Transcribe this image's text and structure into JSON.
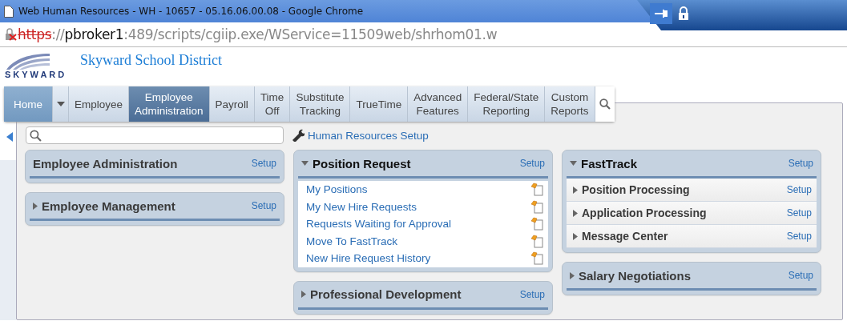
{
  "window": {
    "title": "Web Human Resources - WH - 10657 - 05.16.06.00.08 - Google Chrome"
  },
  "address": {
    "scheme": "https",
    "separator": "://",
    "host": "pbroker1",
    "rest": ":489/scripts/cgiip.exe/WService=11509web/shrhom01.w"
  },
  "brand": {
    "logo_text": "SKYWARD",
    "site_title": "Skyward School District"
  },
  "nav": [
    {
      "label": "Home",
      "kind": "home"
    },
    {
      "label": "Employee",
      "kind": "tab",
      "selected": false
    },
    {
      "label": "Employee\nAdministration",
      "kind": "tab",
      "selected": true
    },
    {
      "label": "Payroll",
      "kind": "tab",
      "selected": false
    },
    {
      "label": "Time\nOff",
      "kind": "tab",
      "selected": false
    },
    {
      "label": "Substitute\nTracking",
      "kind": "tab",
      "selected": false
    },
    {
      "label": "TrueTime",
      "kind": "tab",
      "selected": false
    },
    {
      "label": "Advanced\nFeatures",
      "kind": "tab",
      "selected": false
    },
    {
      "label": "Federal/State\nReporting",
      "kind": "tab",
      "selected": false
    },
    {
      "label": "Custom\nReports",
      "kind": "tab",
      "selected": false
    }
  ],
  "setup_link": "Human Resources Setup",
  "columns": [
    [
      {
        "title": "Employee Administration",
        "setup": "Setup"
      },
      {
        "title": "Employee Management",
        "expanded": false,
        "setup": "Setup"
      }
    ],
    [
      {
        "title": "Position Request",
        "expanded": true,
        "setup": "Setup",
        "items": [
          {
            "kind": "link",
            "label": "My Positions"
          },
          {
            "kind": "link",
            "label": "My New Hire Requests"
          },
          {
            "kind": "link",
            "label": "Requests Waiting for Approval"
          },
          {
            "kind": "link",
            "label": "Move To FastTrack"
          },
          {
            "kind": "link",
            "label": "New Hire Request History"
          }
        ]
      },
      {
        "title": "Professional Development",
        "expanded": false,
        "setup": "Setup"
      }
    ],
    [
      {
        "title": "FastTrack",
        "expanded": true,
        "setup": "Setup",
        "items": [
          {
            "kind": "section",
            "label": "Position Processing",
            "setup": "Setup"
          },
          {
            "kind": "section",
            "label": "Application Processing",
            "setup": "Setup"
          },
          {
            "kind": "section",
            "label": "Message Center",
            "setup": "Setup"
          }
        ]
      },
      {
        "title": "Salary Negotiations",
        "expanded": false,
        "setup": "Setup"
      }
    ]
  ]
}
